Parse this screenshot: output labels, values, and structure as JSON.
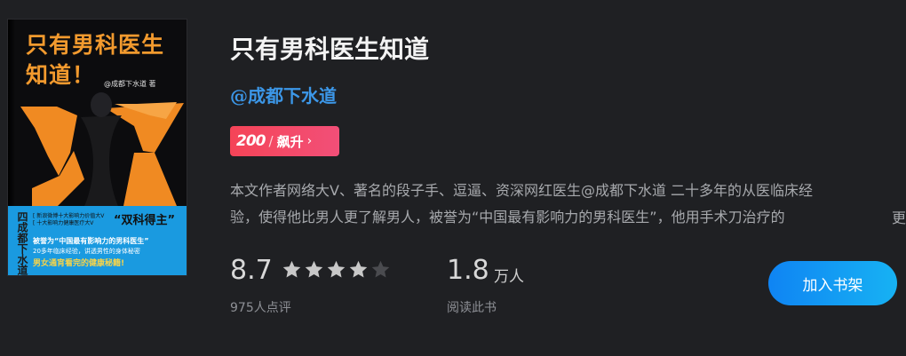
{
  "book": {
    "title": "只有男科医生知道",
    "author": "@成都下水道",
    "cover": {
      "title": "只有男科医生知道！",
      "author_line": "@成都下水道 著",
      "side_text": "四成都下水道",
      "band_line1": "[ 新浪微博十大影响力价值大V",
      "band_line2": "[ 十大影响力健康医疗大V",
      "band_big": "“双科得主”",
      "band_line3": "被誉为“中国最有影响力的男科医生”",
      "band_line4": "20多年临床经验，讲透男性的身体秘密",
      "band_line5": "男女通宵看完的健康秘籍!",
      "colors": {
        "accent": "#f29a2e",
        "band": "#1a9ae0",
        "background": "#0c0c0e"
      }
    }
  },
  "rank_badge": {
    "number": "200",
    "label": "飙升",
    "icon": "chevron-right-icon"
  },
  "description": {
    "line1": "本文作者网络大V、著名的段子手、逗逼、资深网红医生@成都下水道 二十多年的从医临床经",
    "line2": "验，使得他比男人更了解男人，被誉为“中国最有影响力的男科医生”，他用手术刀治疗的",
    "more": "更多"
  },
  "rating": {
    "score": "8.7",
    "stars_filled": 4,
    "stars_total": 5,
    "count_text": "975人点评"
  },
  "readers": {
    "number": "1.8",
    "unit": "万人",
    "label": "阅读此书"
  },
  "actions": {
    "add_to_shelf": "加入书架"
  },
  "colors": {
    "link": "#3c97e8",
    "badge_start": "#f54457",
    "badge_end": "#f24f78",
    "button_start": "#0f84f3",
    "button_end": "#17b2f3"
  }
}
